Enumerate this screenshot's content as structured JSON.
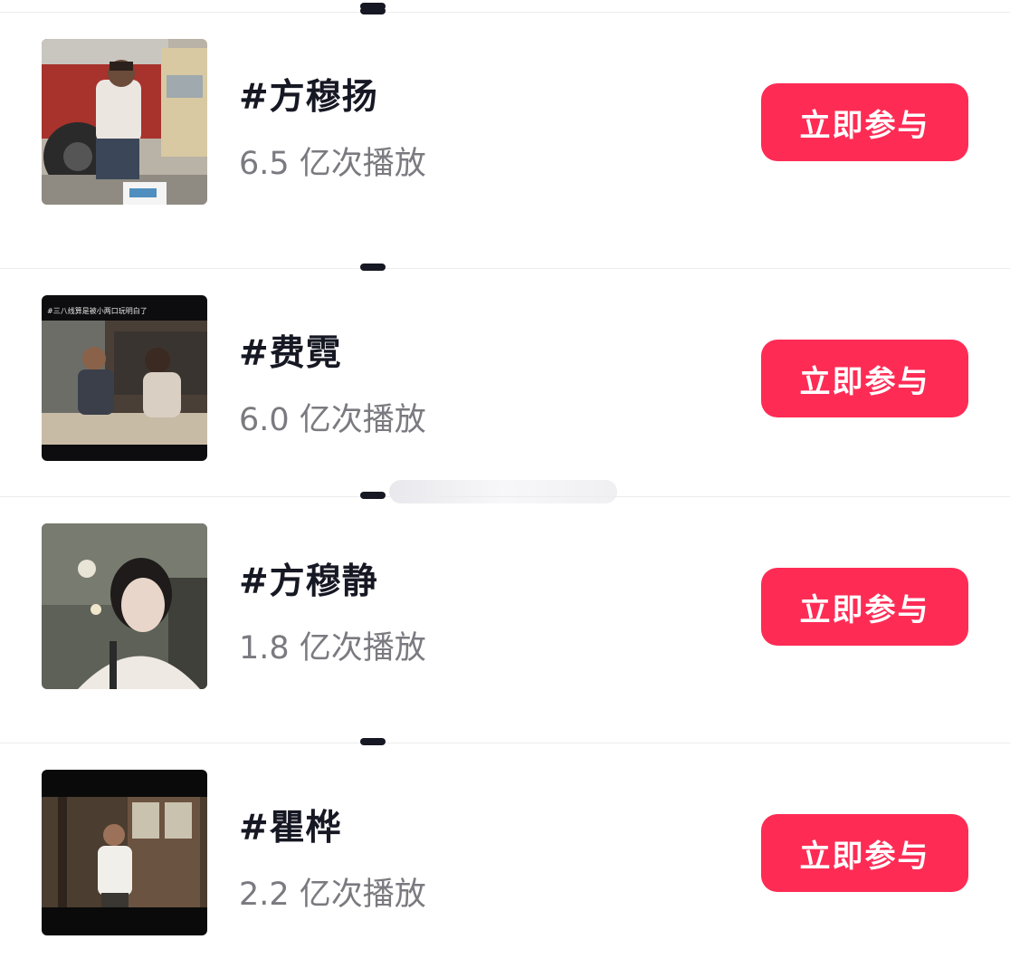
{
  "topics": [
    {
      "title": "#方穆扬",
      "plays": "6.5 亿次播放",
      "button": "立即参与",
      "thumb_icon": "man-sitting-by-truck-photo"
    },
    {
      "title": "#费霓",
      "plays": "6.0 亿次播放",
      "button": "立即参与",
      "thumb_icon": "couple-in-room-photo",
      "thumb_caption": "#三八线算是被小两口玩明白了"
    },
    {
      "title": "#方穆静",
      "plays": "1.8 亿次播放",
      "button": "立即参与",
      "thumb_icon": "woman-portrait-photo"
    },
    {
      "title": "#瞿桦",
      "plays": "2.2 亿次播放",
      "button": "立即参与",
      "thumb_icon": "man-in-doorway-photo"
    }
  ],
  "colors": {
    "accent": "#fe2c55",
    "title": "#161823",
    "subtext": "#7a7a80"
  }
}
